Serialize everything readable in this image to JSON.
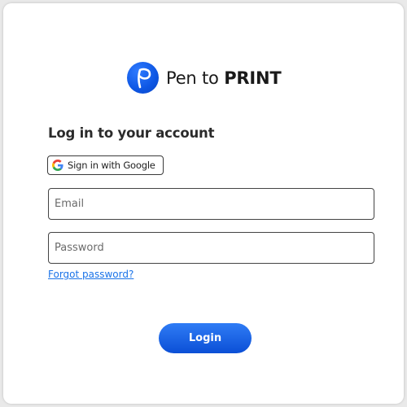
{
  "brand": {
    "name_regular": "Pen to ",
    "name_bold": "PRINT",
    "logo_icon": "pen-to-print-logo-icon",
    "accent_color": "#0d56e3"
  },
  "login": {
    "heading": "Log in to your account",
    "google_button_label": "Sign in with Google",
    "google_icon": "google-g-icon",
    "email_placeholder": "Email",
    "email_value": "",
    "password_placeholder": "Password",
    "password_value": "",
    "forgot_password_label": "Forgot password?",
    "submit_label": "Login"
  }
}
